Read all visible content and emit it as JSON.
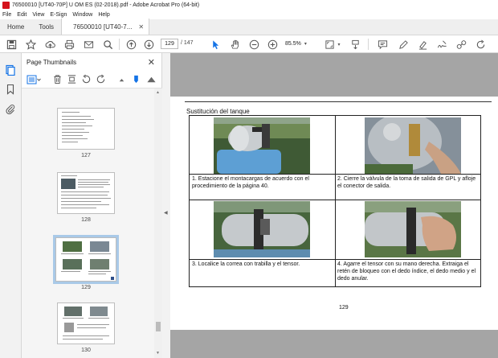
{
  "window": {
    "title": "76500010 [UT40-70P] U OM ES (02-2018).pdf - Adobe Acrobat Pro (64-bit)"
  },
  "menu": [
    "File",
    "Edit",
    "View",
    "E-Sign",
    "Window",
    "Help"
  ],
  "tabs": {
    "home": "Home",
    "tools": "Tools",
    "doc": "76500010 [UT40-7..."
  },
  "toolbar": {
    "page_current": "129",
    "page_total": "/ 147",
    "zoom": "85.5%"
  },
  "thumb_panel": {
    "title": "Page Thumbnails",
    "pages": [
      "127",
      "128",
      "129",
      "130"
    ]
  },
  "document": {
    "section_title": "Sustitución del tanque",
    "steps": [
      "1. Estacione el montacargas de acuerdo con el procedimiento de la página 40.",
      "2. Cierre la válvula de la toma de salida de GPL y afloje el conector de salida.",
      "3. Localice la correa con trabilla y el tensor.",
      "4. Agarre el tensor con su mano derecha. Extraiga el retén de bloqueo con el dedo índice, el dedo medio y el dedo anular."
    ],
    "page_number": "129"
  },
  "colors": {
    "accent": "#1473e6",
    "selected_thumb": "#a9c9e8"
  }
}
